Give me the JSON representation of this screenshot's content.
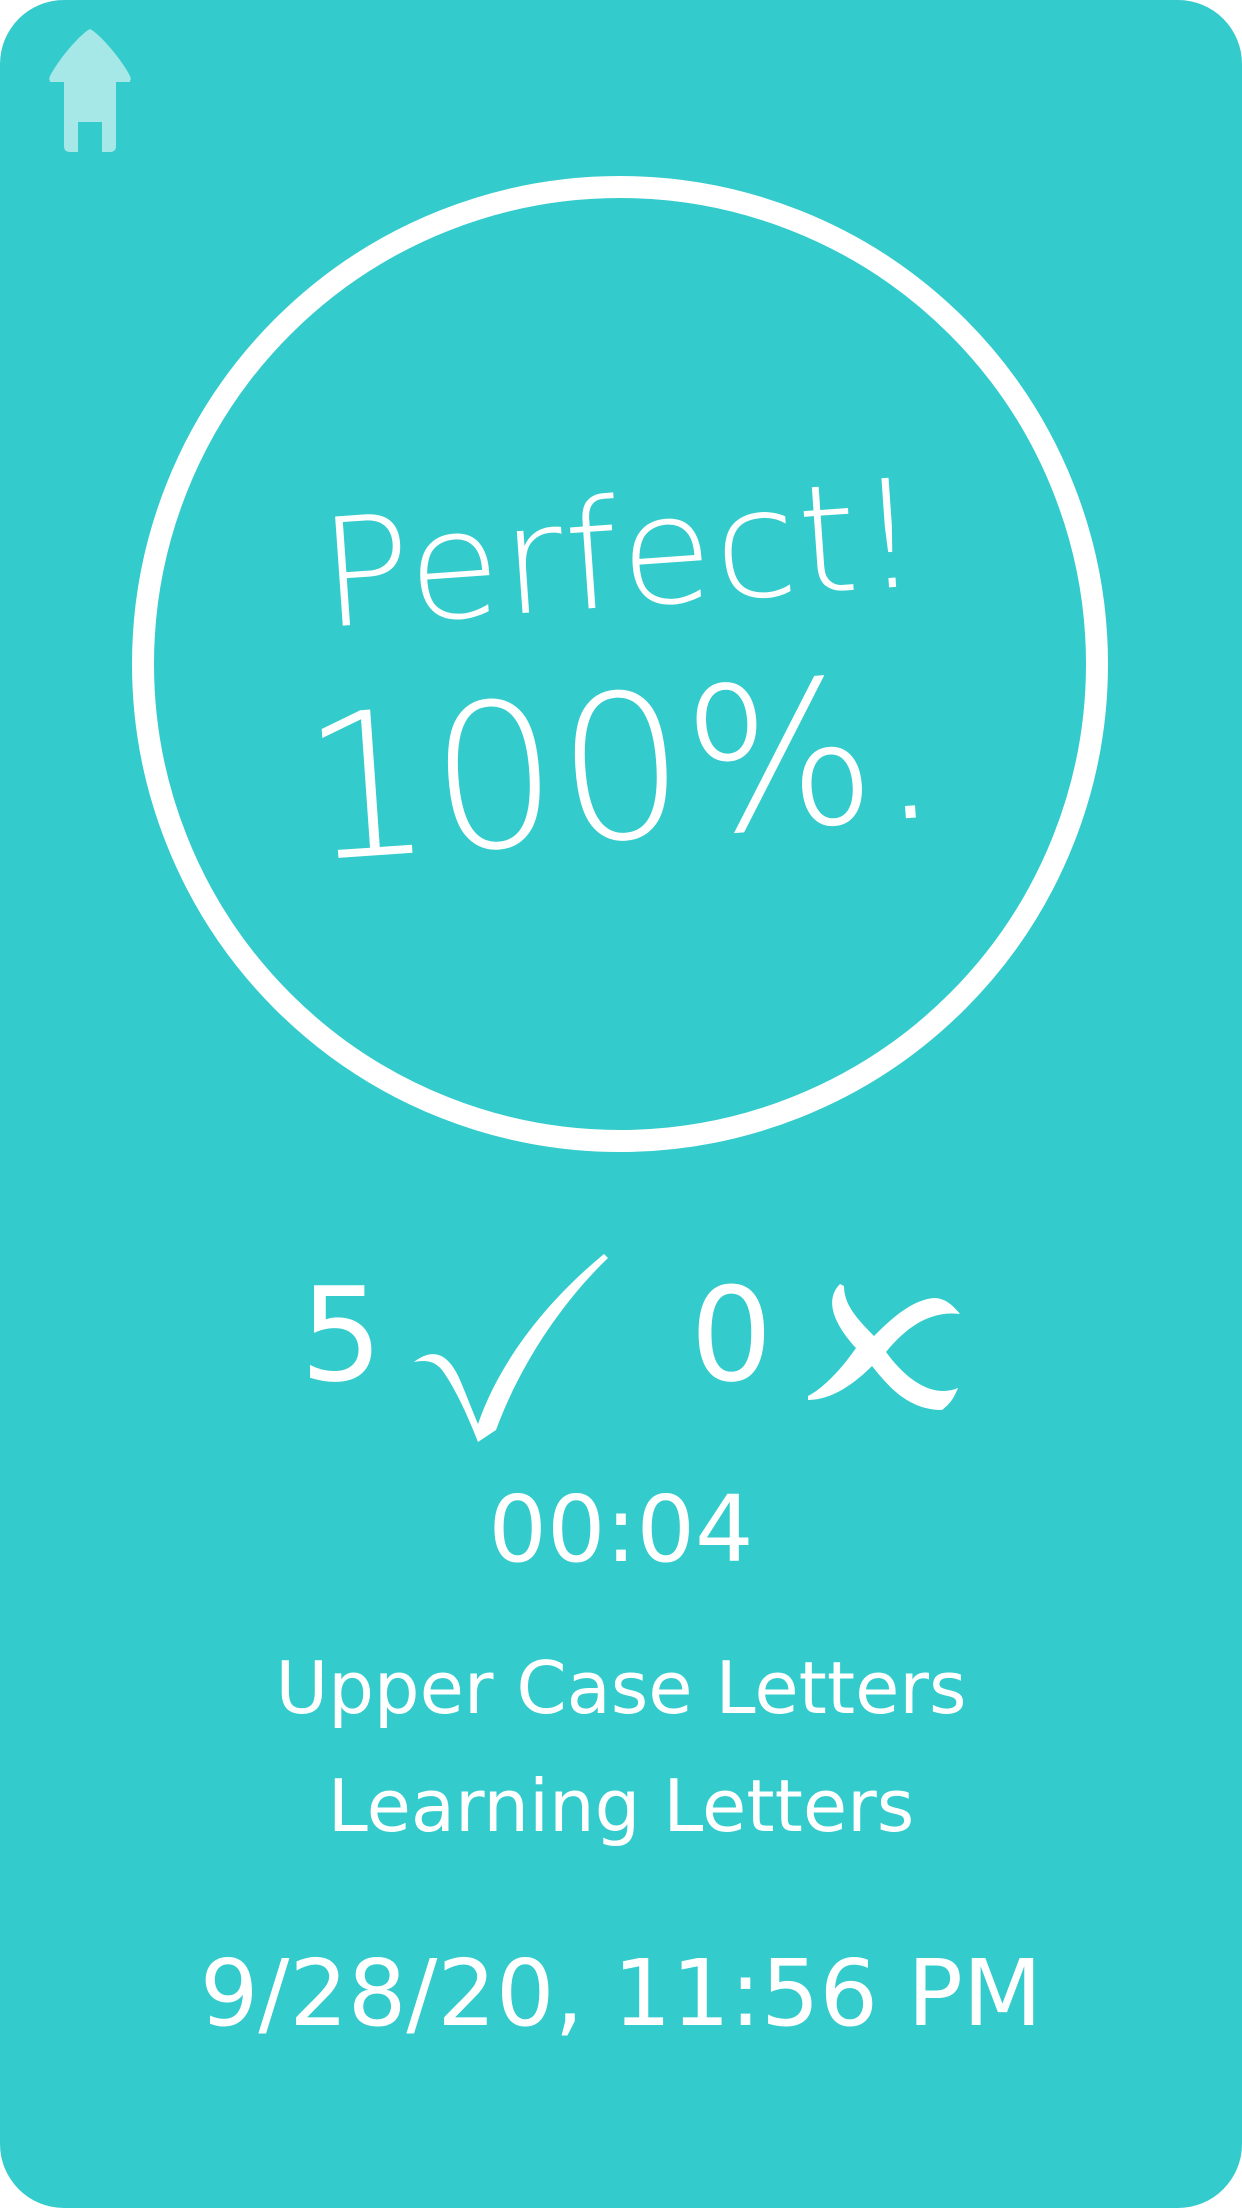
{
  "colors": {
    "background": "#34cbcc",
    "foreground": "#ffffff",
    "home_icon": "#a6e8e8"
  },
  "home": {
    "icon": "home-icon"
  },
  "result": {
    "headline": "Perfect!",
    "percent": "100%.",
    "correct_count": "5",
    "correct_icon": "checkmark-icon",
    "incorrect_count": "0",
    "incorrect_icon": "cross-icon",
    "elapsed_time": "00:04"
  },
  "lesson": {
    "category": "Upper Case Letters",
    "activity": "Learning Letters"
  },
  "timestamp": "9/28/20, 11:56 PM"
}
